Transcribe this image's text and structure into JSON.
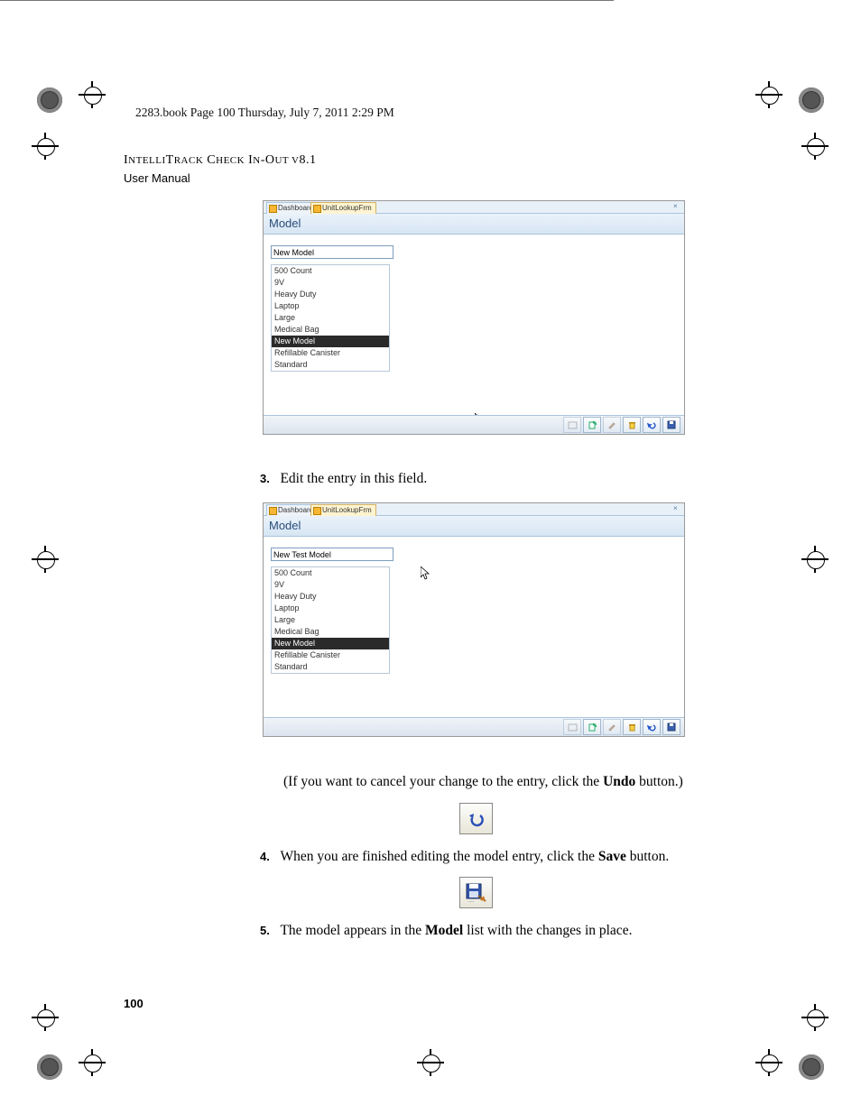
{
  "header": {
    "book_info": "2283.book  Page 100  Thursday, July 7, 2011  2:29 PM",
    "product_line1": "IntelliTrack Check In-Out v8.1",
    "product_line2": "User Manual"
  },
  "screenshot1": {
    "inactive_tab": "Dashboard",
    "active_tab": "UnitLookupFrm",
    "title": "Model",
    "input_value": "New Model",
    "items": [
      "500 Count",
      "9V",
      "Heavy Duty",
      "Laptop",
      "Large",
      "Medical Bag",
      "New Model",
      "Refillable Canister",
      "Standard"
    ],
    "selected_index": 6
  },
  "screenshot2": {
    "inactive_tab": "Dashboard",
    "active_tab": "UnitLookupFrm",
    "title": "Model",
    "input_value": "New Test Model",
    "items": [
      "500 Count",
      "9V",
      "Heavy Duty",
      "Laptop",
      "Large",
      "Medical Bag",
      "New Model",
      "Refillable Canister",
      "Standard"
    ],
    "selected_index": 6
  },
  "steps": {
    "s3_num": "3.",
    "s3_text": "Edit the entry in this field.",
    "cancel_text_1": "(If you want to cancel your change to the entry, click the ",
    "cancel_bold": "Undo",
    "cancel_text_2": " button.)",
    "s4_num": "4.",
    "s4_text_1": "When you are finished editing the model entry, click the ",
    "s4_bold": "Save",
    "s4_text_2": " button.",
    "s5_num": "5.",
    "s5_text_1": "The model appears in the ",
    "s5_bold": "Model",
    "s5_text_2": " list with the changes in place."
  },
  "page_number": "100"
}
